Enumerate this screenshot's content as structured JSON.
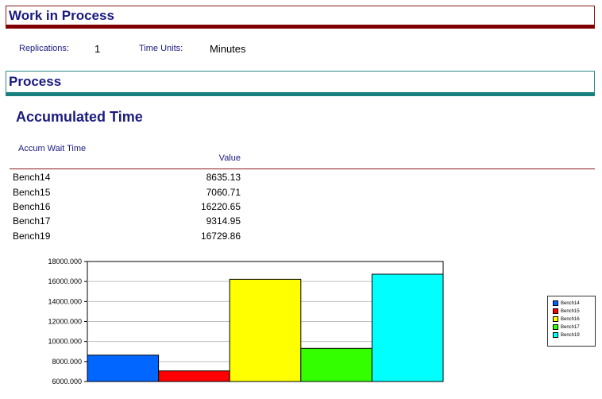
{
  "header": {
    "title": "Work in Process"
  },
  "info": {
    "replications_label": "Replications:",
    "replications_value": "1",
    "time_units_label": "Time Units:",
    "time_units_value": "Minutes"
  },
  "process_header": {
    "title": "Process"
  },
  "section": {
    "title": "Accumulated Time",
    "stat_name": "Accum Wait Time",
    "column_header": "Value"
  },
  "rows": [
    {
      "name": "Bench14",
      "value": "8635.13"
    },
    {
      "name": "Bench15",
      "value": "7060.71"
    },
    {
      "name": "Bench16",
      "value": "16220.65"
    },
    {
      "name": "Bench17",
      "value": "9314.95"
    },
    {
      "name": "Bench19",
      "value": "16729.86"
    }
  ],
  "colors": {
    "header_text": "#1a1a80",
    "header_border_wip": "#800000",
    "header_border_process": "#1a7f7f"
  },
  "chart_data": {
    "type": "bar",
    "categories": [
      "Bench14",
      "Bench15",
      "Bench16",
      "Bench17",
      "Bench19"
    ],
    "values": [
      8635.13,
      7060.71,
      16220.65,
      9314.95,
      16729.86
    ],
    "colors": [
      "#0066ff",
      "#ff0000",
      "#ffff00",
      "#33ff00",
      "#00ffff"
    ],
    "ylim": [
      6000,
      18000
    ],
    "yticks": [
      "18000.000",
      "16000.000",
      "14000.000",
      "12000.000",
      "10000.000",
      "8000.000",
      "6000.000"
    ],
    "ytick_values": [
      18000,
      16000,
      14000,
      12000,
      10000,
      8000,
      6000
    ],
    "legend": [
      "Bench14",
      "Bench15",
      "Bench16",
      "Bench17",
      "Bench19"
    ],
    "legend_position": "right",
    "grid": true,
    "title": "",
    "xlabel": "",
    "ylabel": ""
  }
}
